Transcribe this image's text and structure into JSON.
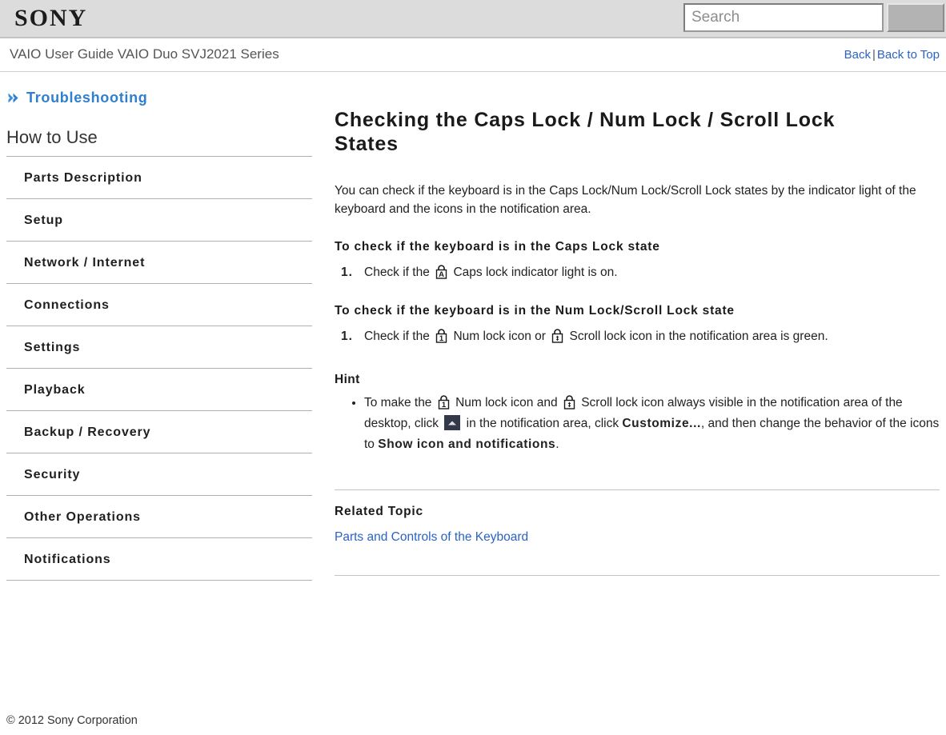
{
  "header": {
    "logo": "SONY",
    "search": {
      "placeholder": "Search",
      "value": "",
      "button_label": ""
    }
  },
  "title_bar": {
    "guide_title": "VAIO User Guide VAIO Duo SVJ2021 Series",
    "back_label": "Back",
    "separator": "|",
    "back_to_top_label": "Back to Top"
  },
  "sidebar": {
    "troubleshooting_label": "Troubleshooting",
    "section_heading": "How to Use",
    "items": [
      {
        "label": "Parts Description"
      },
      {
        "label": "Setup"
      },
      {
        "label": "Network / Internet"
      },
      {
        "label": "Connections"
      },
      {
        "label": "Settings"
      },
      {
        "label": "Playback"
      },
      {
        "label": "Backup / Recovery"
      },
      {
        "label": "Security"
      },
      {
        "label": "Other Operations"
      },
      {
        "label": "Notifications"
      }
    ]
  },
  "main": {
    "doc_title_line1": "Checking the Caps Lock / Num Lock / Scroll Lock",
    "doc_title_line2": "States",
    "intro": "You can check if the keyboard is in the Caps Lock/Num Lock/Scroll Lock states by the indicator light of the keyboard and the icons in the notification area.",
    "caps_section": {
      "heading": "To check if the keyboard is in the Caps Lock state",
      "step_prefix": "Check if the",
      "step_suffix": "Caps lock indicator light is on."
    },
    "numscroll_section": {
      "heading": "To check if the keyboard is in the Num Lock/Scroll Lock state",
      "step_part1": "Check if the",
      "step_part2": "Num lock icon or",
      "step_part3": "Scroll lock icon in the notification area is green."
    },
    "hint": {
      "heading": "Hint",
      "part1": "To make the",
      "part2": "Num lock icon and",
      "part3": "Scroll lock icon always visible in the notification area of the desktop, click",
      "part4": "in the notification area, click",
      "customize_label": "Customize...",
      "part5": ", and then change the behavior of the icons to",
      "show_icon_label": "Show icon and notifications",
      "part6": "."
    },
    "related": {
      "heading": "Related Topic",
      "link_label": "Parts and Controls of the Keyboard"
    },
    "icons": {
      "caps_lock": "caps-lock-icon",
      "num_lock": "num-lock-icon",
      "scroll_lock": "scroll-lock-icon",
      "tray_expand": "tray-expand-arrow-icon"
    }
  },
  "footer": {
    "copyright": "© 2012 Sony Corporation"
  },
  "colors": {
    "link": "#2a63c4",
    "accent_blue": "#2f7fd0",
    "header_band": "#dcdcdc",
    "tray_button": "#33384a"
  }
}
